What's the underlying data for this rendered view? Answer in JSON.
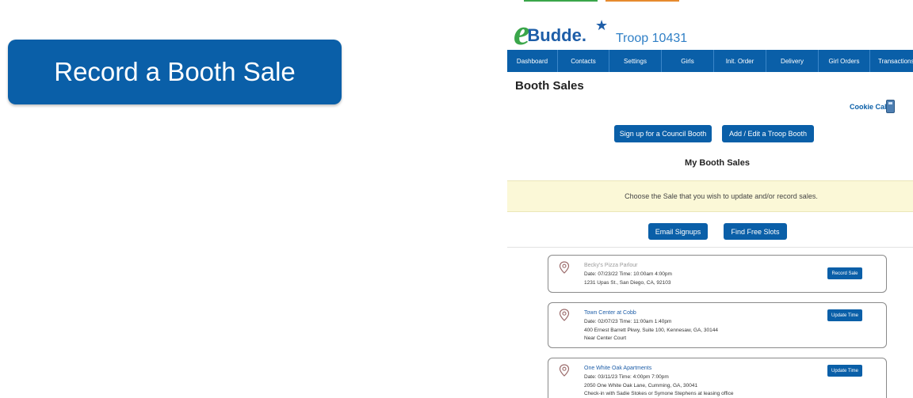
{
  "big_button": {
    "label": "Record a Booth Sale"
  },
  "app": {
    "logo": {
      "e": "e",
      "text": "Budde."
    },
    "troop": "Troop 10431",
    "nav": [
      "Dashboard",
      "Contacts",
      "Settings",
      "Girls",
      "Init. Order",
      "Delivery",
      "Girl Orders",
      "Transactions"
    ],
    "page_title": "Booth Sales",
    "cookie_calc": "Cookie Calc.",
    "buttons": {
      "council": "Sign up for a Council Booth",
      "troop": "Add / Edit a Troop Booth",
      "email": "Email Signups",
      "free": "Find Free Slots"
    },
    "my_sales_heading": "My Booth Sales",
    "notice": "Choose the Sale that you wish to update and/or record sales.",
    "sales": [
      {
        "name": "Becky's Pizza Parlour",
        "date_time": "Date: 07/23/22   Time: 10:00am 4:00pm",
        "address": "1231 Upas St., San Diego, CA, 92103",
        "note": "",
        "action": "Record Sale"
      },
      {
        "name": "Town Center at Cobb",
        "date_time": "Date: 02/07/23   Time: 11:00am 1:40pm",
        "address": "400 Ernest Barrett Pkwy, Suite 100, Kennesaw, GA, 30144",
        "note": "Near Center Court",
        "action": "Update Time"
      },
      {
        "name": "One White Oak Apartments",
        "date_time": "Date: 03/11/23   Time: 4:00pm 7:00pm",
        "address": "2050 One White Oak Lane, Cumming, GA, 30041",
        "note": "Check-in with Sadie Stokes or Symone Stephens at leasing office",
        "action": "Update Time"
      }
    ]
  },
  "colors": {
    "primary": "#0a5fa8",
    "logo_green": "#3aa64a",
    "notice_bg": "#fbf8d7"
  },
  "icons": [
    "map-pin-icon",
    "calculator-icon",
    "star-icon"
  ]
}
